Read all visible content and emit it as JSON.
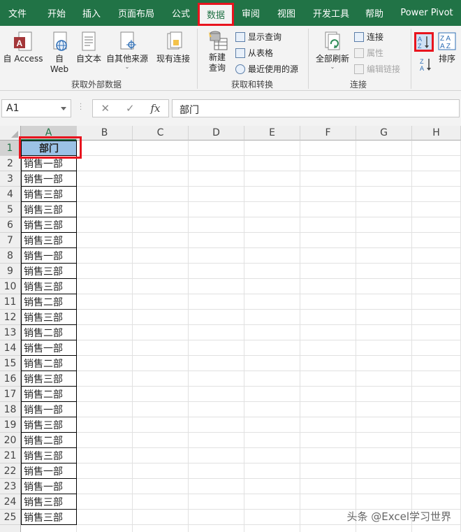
{
  "tabs": [
    "文件",
    "开始",
    "插入",
    "页面布局",
    "公式",
    "数据",
    "审阅",
    "视图",
    "开发工具",
    "帮助",
    "Power Pivot"
  ],
  "active_tab": "数据",
  "ribbon": {
    "get_external": {
      "label": "获取外部数据",
      "access": "自 Access",
      "web_line1": "自",
      "web_line2": "Web",
      "text": "自文本",
      "other": "自其他来源",
      "existing": "现有连接"
    },
    "get_transform": {
      "label": "获取和转换",
      "new_query_line1": "新建",
      "new_query_line2": "查询",
      "show_queries": "显示查询",
      "from_table": "从表格",
      "recent_sources": "最近使用的源"
    },
    "connections": {
      "label": "连接",
      "refresh_all": "全部刷新",
      "connections": "连接",
      "properties": "属性",
      "edit_links": "编辑链接"
    },
    "sort": {
      "sort_asc_icon": "sort-a-z-icon",
      "sort_desc_icon": "sort-z-a-icon",
      "sort_label": "排序"
    }
  },
  "formula_bar": {
    "name_box": "A1",
    "cancel": "✕",
    "enter": "✓",
    "fx": "fx",
    "content": "部门"
  },
  "columns": [
    "A",
    "B",
    "C",
    "D",
    "E",
    "F",
    "G",
    "H"
  ],
  "rows": [
    "1",
    "2",
    "3",
    "4",
    "5",
    "6",
    "7",
    "8",
    "9",
    "10",
    "11",
    "12",
    "13",
    "14",
    "15",
    "16",
    "17",
    "18",
    "19",
    "20",
    "21",
    "22",
    "23",
    "24",
    "25"
  ],
  "column_a": [
    "部门",
    "销售一部",
    "销售一部",
    "销售三部",
    "销售三部",
    "销售三部",
    "销售三部",
    "销售一部",
    "销售三部",
    "销售三部",
    "销售二部",
    "销售三部",
    "销售二部",
    "销售一部",
    "销售二部",
    "销售三部",
    "销售二部",
    "销售一部",
    "销售三部",
    "销售二部",
    "销售三部",
    "销售一部",
    "销售一部",
    "销售三部",
    "销售三部"
  ],
  "watermark": "头条 @Excel学习世界"
}
